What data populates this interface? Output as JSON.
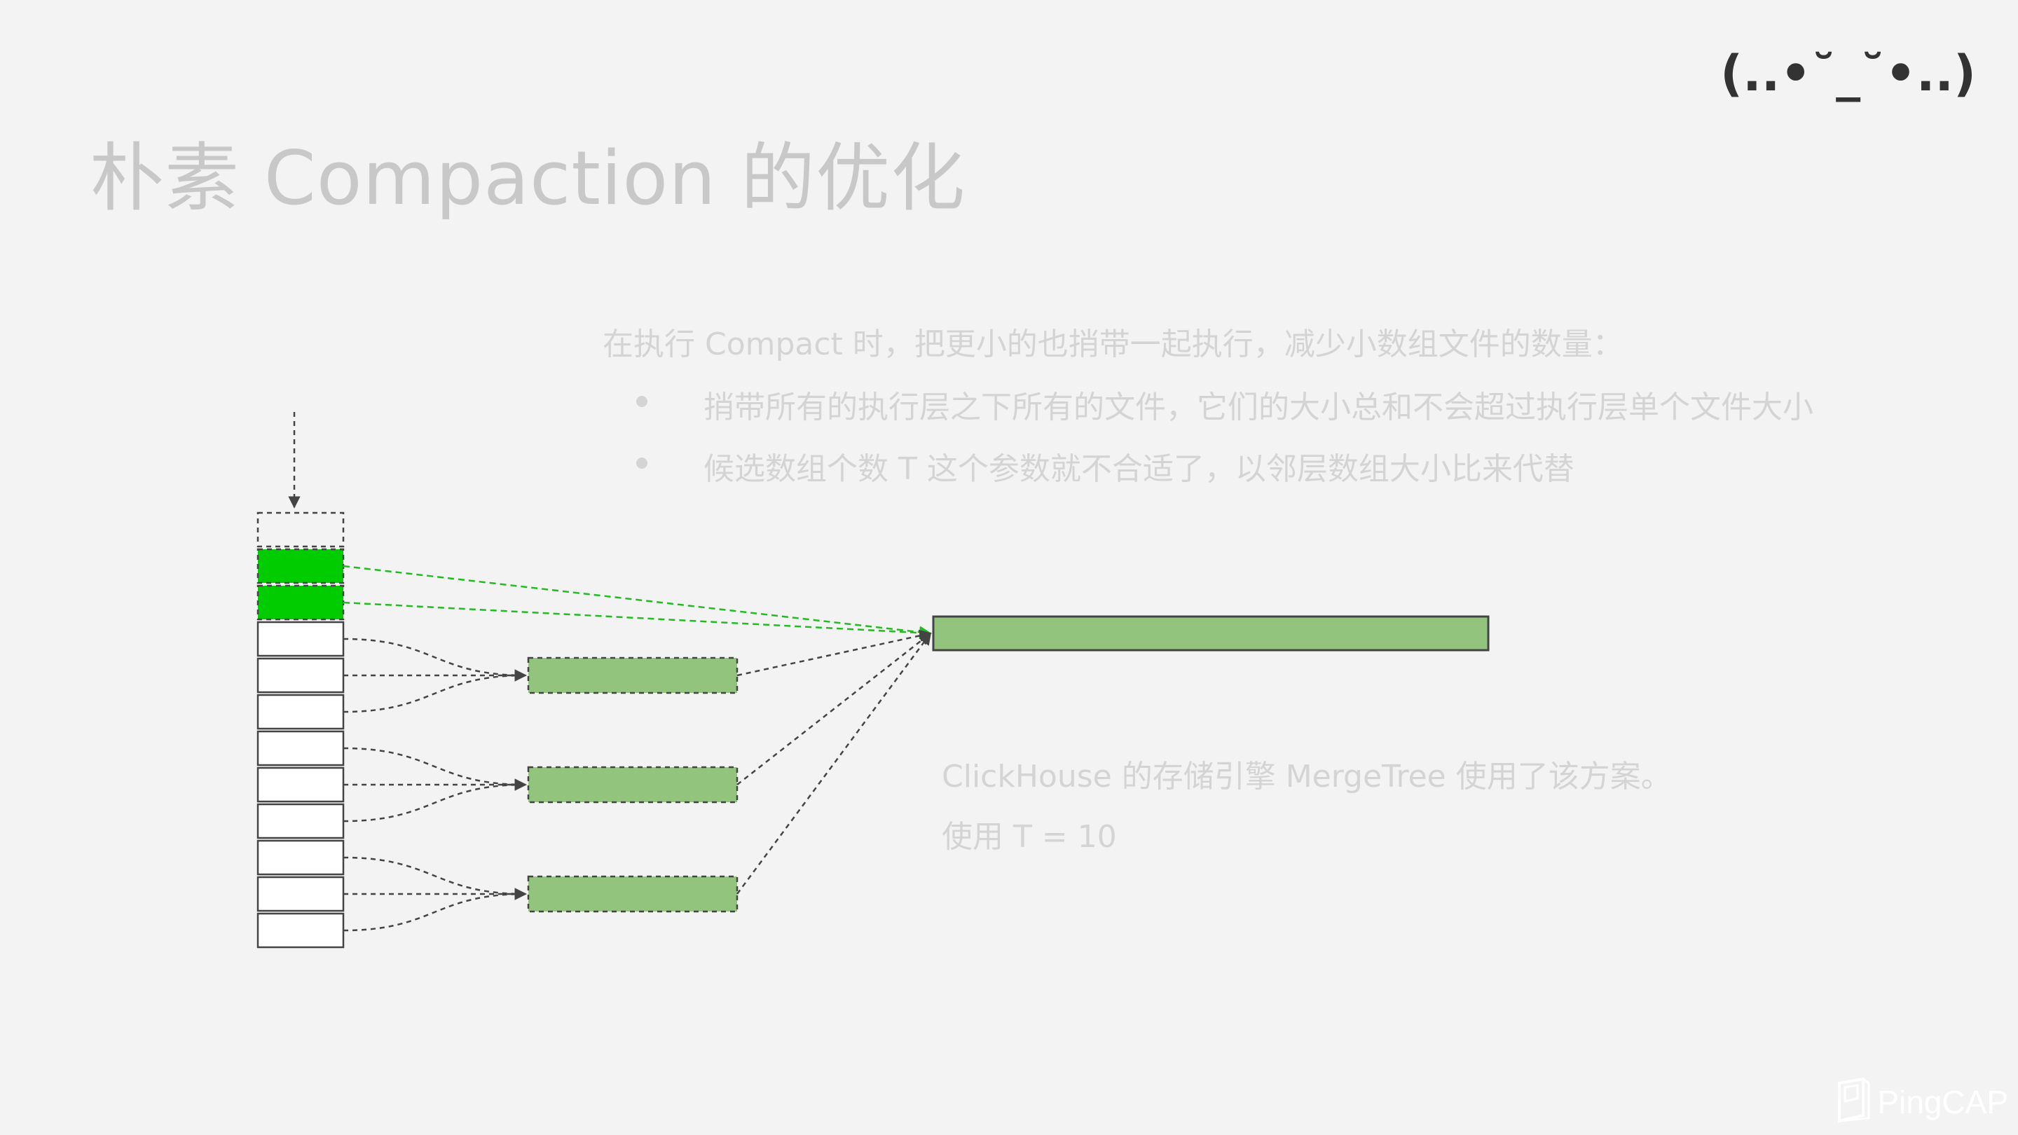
{
  "title": "朴素 Compaction 的优化",
  "emoticon": "(..•˘_˘•..)",
  "intro": "在执行 Compact 时，把更小的也捎带一起执行，减少小数组文件的数量：",
  "bullets": [
    "捎带所有的执行层之下所有的文件，它们的大小总和不会超过执行层单个文件大小",
    "候选数组个数 T 这个参数就不合适了，以邻层数组大小比来代替"
  ],
  "note_lines": [
    "ClickHouse 的存储引擎 MergeTree 使用了该方案。",
    "使用 T = 10"
  ],
  "logo_text": "PingCAP",
  "colors": {
    "background": "#f3f3f3",
    "bright_green": "#00cc00",
    "merged_green": "#93c47d",
    "outline": "#444444",
    "green_arrow": "#22bb22"
  },
  "diagram": {
    "stack_slots": [
      "empty",
      "green",
      "green",
      "white",
      "white",
      "white",
      "white",
      "white",
      "white",
      "white",
      "white",
      "white"
    ],
    "group_sizes": [
      3,
      3,
      3
    ],
    "stack_icon": "file-stack",
    "merge_icon": "merged-file"
  }
}
